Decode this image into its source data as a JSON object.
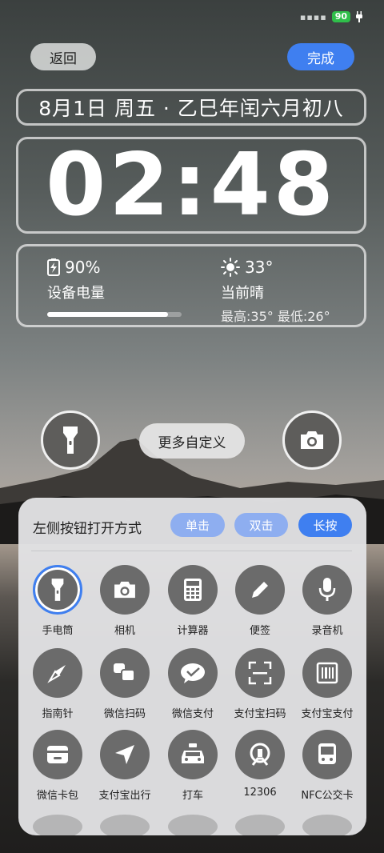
{
  "status": {
    "battery": "90"
  },
  "header": {
    "back_label": "返回",
    "done_label": "完成"
  },
  "widget": {
    "date": "8月1日 周五 · 乙巳年闰六月初八",
    "time": "02:48",
    "battery": {
      "percent_text": "90%",
      "label": "设备电量",
      "level": 0.9
    },
    "weather": {
      "temp": "33°",
      "condition": "当前晴",
      "range": "最高:35° 最低:26°"
    }
  },
  "shortcuts": {
    "left_icon": "flashlight-icon",
    "right_icon": "camera-icon",
    "more_label": "更多自定义"
  },
  "panel": {
    "title": "左侧按钮打开方式",
    "modes": [
      "单击",
      "双击",
      "长按"
    ],
    "selected_mode": "长按",
    "apps": [
      {
        "label": "手电筒",
        "icon": "flashlight-icon",
        "selected": true
      },
      {
        "label": "相机",
        "icon": "camera-icon"
      },
      {
        "label": "计算器",
        "icon": "calculator-icon"
      },
      {
        "label": "便签",
        "icon": "pencil-icon"
      },
      {
        "label": "录音机",
        "icon": "microphone-icon"
      },
      {
        "label": "指南针",
        "icon": "compass-icon"
      },
      {
        "label": "微信扫码",
        "icon": "wechat-scan-icon"
      },
      {
        "label": "微信支付",
        "icon": "wechat-pay-icon"
      },
      {
        "label": "支付宝扫码",
        "icon": "scan-icon"
      },
      {
        "label": "支付宝支付",
        "icon": "barcode-icon"
      },
      {
        "label": "微信卡包",
        "icon": "wallet-icon"
      },
      {
        "label": "支付宝出行",
        "icon": "navigation-arrow-icon"
      },
      {
        "label": "打车",
        "icon": "taxi-icon"
      },
      {
        "label": "12306",
        "icon": "railway-icon"
      },
      {
        "label": "NFC公交卡",
        "icon": "bus-card-icon"
      }
    ]
  }
}
